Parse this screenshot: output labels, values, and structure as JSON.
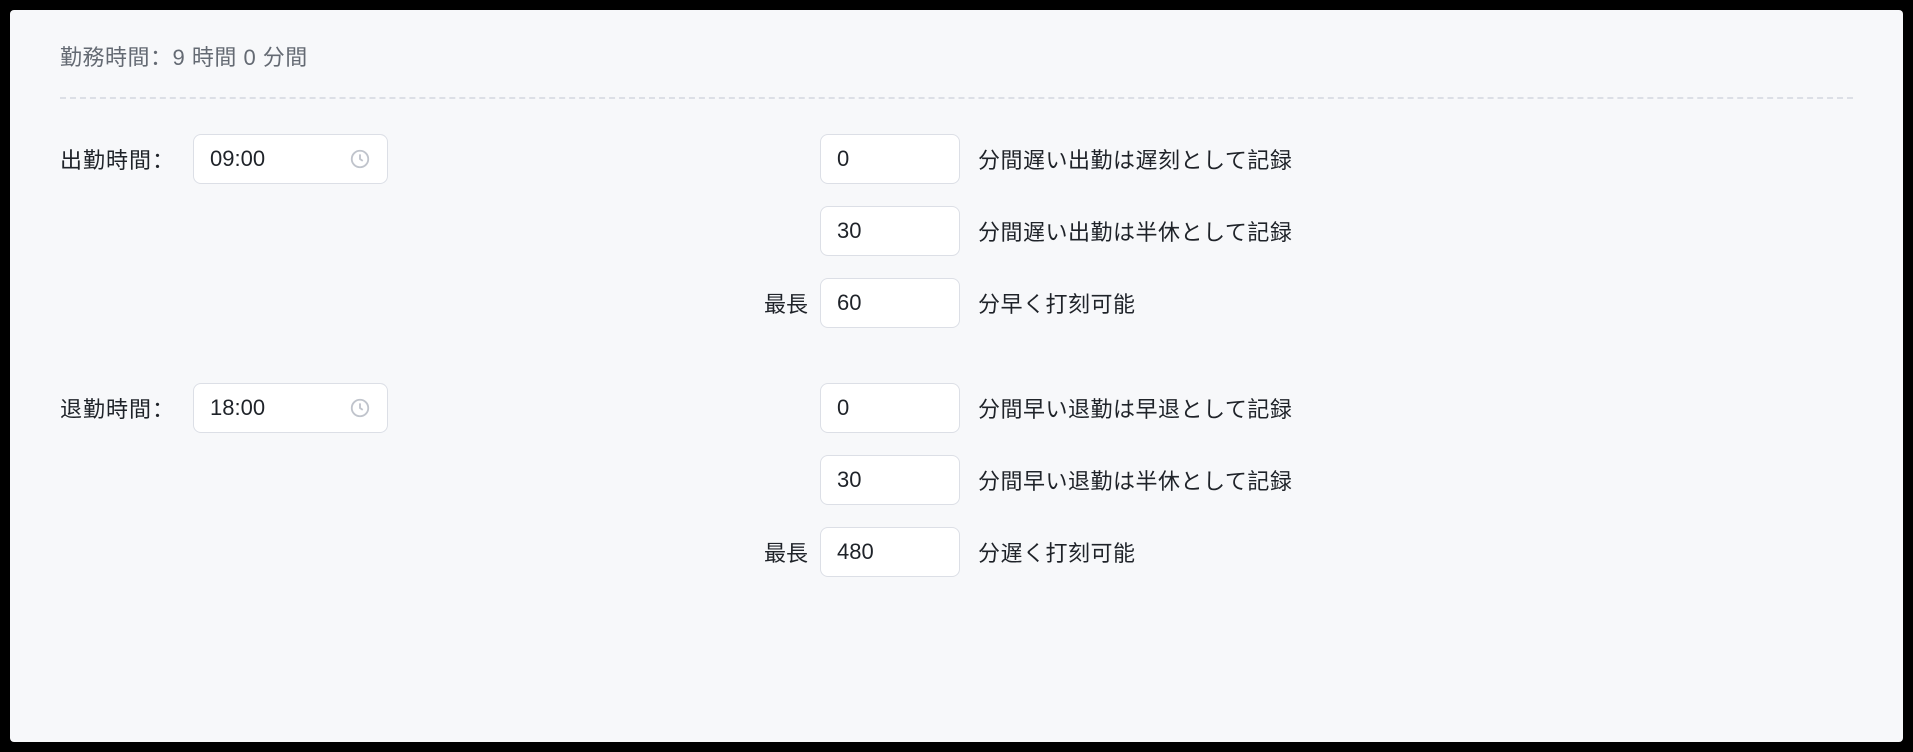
{
  "summary": "勤務時間：9 時間 0 分間",
  "start": {
    "label": "出勤時間：",
    "time": "09:00",
    "rules": {
      "late_value": "0",
      "late_suffix": "分間遅い出勤は遅刻として記録",
      "half_value": "30",
      "half_suffix": "分間遅い出勤は半休として記録",
      "early_prefix": "最長",
      "early_value": "60",
      "early_suffix": "分早く打刻可能"
    }
  },
  "end": {
    "label": "退勤時間：",
    "time": "18:00",
    "rules": {
      "early_leave_value": "0",
      "early_leave_suffix": "分間早い退勤は早退として記録",
      "half_value": "30",
      "half_suffix": "分間早い退勤は半休として記録",
      "late_prefix": "最長",
      "late_value": "480",
      "late_suffix": "分遅く打刻可能"
    }
  }
}
